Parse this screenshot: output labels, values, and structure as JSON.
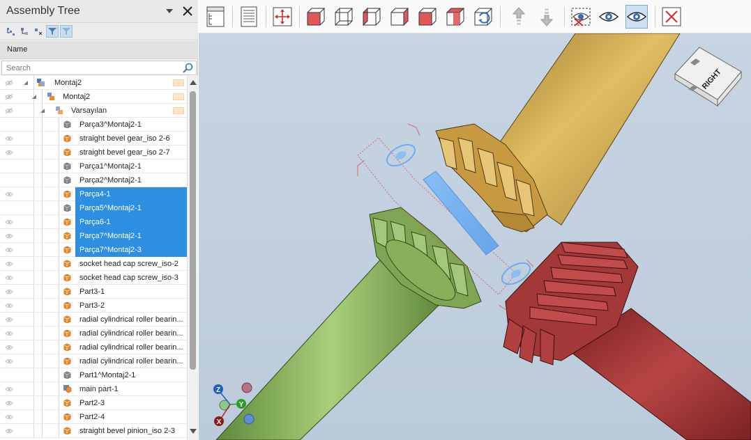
{
  "panel": {
    "title": "Assembly Tree",
    "column_header": "Name",
    "search_placeholder": "Search"
  },
  "tree": {
    "items": [
      {
        "label": "Montaj2",
        "icon": "assembly-icon",
        "level": 0,
        "selected": false,
        "eye": "hidden",
        "toggle": true,
        "swatch": true
      },
      {
        "label": "Montaj2",
        "icon": "subassembly-icon",
        "level": 1,
        "selected": false,
        "eye": "hidden",
        "toggle": true,
        "swatch": true
      },
      {
        "label": "Varsayılan",
        "icon": "configuration-icon",
        "level": 2,
        "selected": false,
        "eye": "hidden",
        "toggle": true,
        "swatch": true
      },
      {
        "label": "Parça3^Montaj2-1",
        "icon": "part-gray-icon",
        "level": 3,
        "selected": false,
        "eye": "none"
      },
      {
        "label": "straight bevel gear_iso 2-6",
        "icon": "part-orange-icon",
        "level": 3,
        "selected": false,
        "eye": "visible"
      },
      {
        "label": "straight bevel gear_iso 2-7",
        "icon": "part-orange-icon",
        "level": 3,
        "selected": false,
        "eye": "visible"
      },
      {
        "label": "Parça1^Montaj2-1",
        "icon": "part-gray-icon",
        "level": 3,
        "selected": false,
        "eye": "none"
      },
      {
        "label": "Parça2^Montaj2-1",
        "icon": "part-gray-icon",
        "level": 3,
        "selected": false,
        "eye": "none"
      },
      {
        "label": "Parça4-1",
        "icon": "part-orange-icon",
        "level": 3,
        "selected": true,
        "eye": "visible"
      },
      {
        "label": "Parça5^Montaj2-1",
        "icon": "part-gray-icon",
        "level": 3,
        "selected": true,
        "eye": "none"
      },
      {
        "label": "Parça6-1",
        "icon": "part-orange-icon",
        "level": 3,
        "selected": true,
        "eye": "visible"
      },
      {
        "label": "Parça7^Montaj2-1",
        "icon": "part-orange-icon",
        "level": 3,
        "selected": true,
        "eye": "visible"
      },
      {
        "label": "Parça7^Montaj2-3",
        "icon": "part-orange-icon",
        "level": 3,
        "selected": true,
        "eye": "visible"
      },
      {
        "label": "socket head cap screw_iso-2",
        "icon": "part-orange-icon",
        "level": 3,
        "selected": false,
        "eye": "visible"
      },
      {
        "label": "socket head cap screw_iso-3",
        "icon": "part-orange-icon",
        "level": 3,
        "selected": false,
        "eye": "visible"
      },
      {
        "label": "Part3-1",
        "icon": "part-orange-icon",
        "level": 3,
        "selected": false,
        "eye": "visible"
      },
      {
        "label": "Part3-2",
        "icon": "part-orange-icon",
        "level": 3,
        "selected": false,
        "eye": "visible"
      },
      {
        "label": "radial cylindrical roller bearin...",
        "icon": "part-orange-icon",
        "level": 3,
        "selected": false,
        "eye": "visible"
      },
      {
        "label": "radial cylindrical roller bearin...",
        "icon": "part-orange-icon",
        "level": 3,
        "selected": false,
        "eye": "visible"
      },
      {
        "label": "radial cylindrical roller bearin...",
        "icon": "part-orange-icon",
        "level": 3,
        "selected": false,
        "eye": "visible"
      },
      {
        "label": "radial cylindrical roller bearin...",
        "icon": "part-orange-icon",
        "level": 3,
        "selected": false,
        "eye": "visible"
      },
      {
        "label": "Part1^Montaj2-1",
        "icon": "part-gray-icon",
        "level": 3,
        "selected": false,
        "eye": "none"
      },
      {
        "label": "main part-1",
        "icon": "part-multi-icon",
        "level": 3,
        "selected": false,
        "eye": "visible"
      },
      {
        "label": "Part2-3",
        "icon": "part-orange-icon",
        "level": 3,
        "selected": false,
        "eye": "visible"
      },
      {
        "label": "Part2-4",
        "icon": "part-orange-icon",
        "level": 3,
        "selected": false,
        "eye": "visible"
      },
      {
        "label": "straight bevel pinion_iso 2-3",
        "icon": "part-orange-icon",
        "level": 3,
        "selected": false,
        "eye": "visible"
      }
    ]
  },
  "toolbar": {
    "buttons": [
      {
        "name": "structure-view-icon",
        "active": false
      },
      {
        "name": "properties-sheet-icon",
        "active": false
      },
      {
        "name": "fit-all-icon",
        "active": false
      },
      {
        "name": "view-front-icon",
        "active": false
      },
      {
        "name": "view-back-icon",
        "active": false
      },
      {
        "name": "view-left-icon",
        "active": false
      },
      {
        "name": "view-right-icon",
        "active": false
      },
      {
        "name": "view-top-icon",
        "active": false
      },
      {
        "name": "view-bottom-icon",
        "active": false
      },
      {
        "name": "view-isometric-icon",
        "active": false
      },
      {
        "name": "move-up-icon",
        "active": false
      },
      {
        "name": "move-down-icon",
        "active": false
      },
      {
        "name": "hide-selected-icon",
        "active": false
      },
      {
        "name": "show-icon",
        "active": false
      },
      {
        "name": "show-selected-icon",
        "active": true
      },
      {
        "name": "close-icon",
        "active": false
      }
    ]
  },
  "viewport": {
    "view_cube_label": "RIGHT",
    "axes": {
      "z": "Z",
      "y": "Y",
      "x": "X"
    },
    "colors": {
      "yellow_part": "#c9a24b",
      "green_part": "#7aa252",
      "red_part": "#a63a3a",
      "selection": "#6aaef5",
      "background": "#bfcddc"
    }
  }
}
